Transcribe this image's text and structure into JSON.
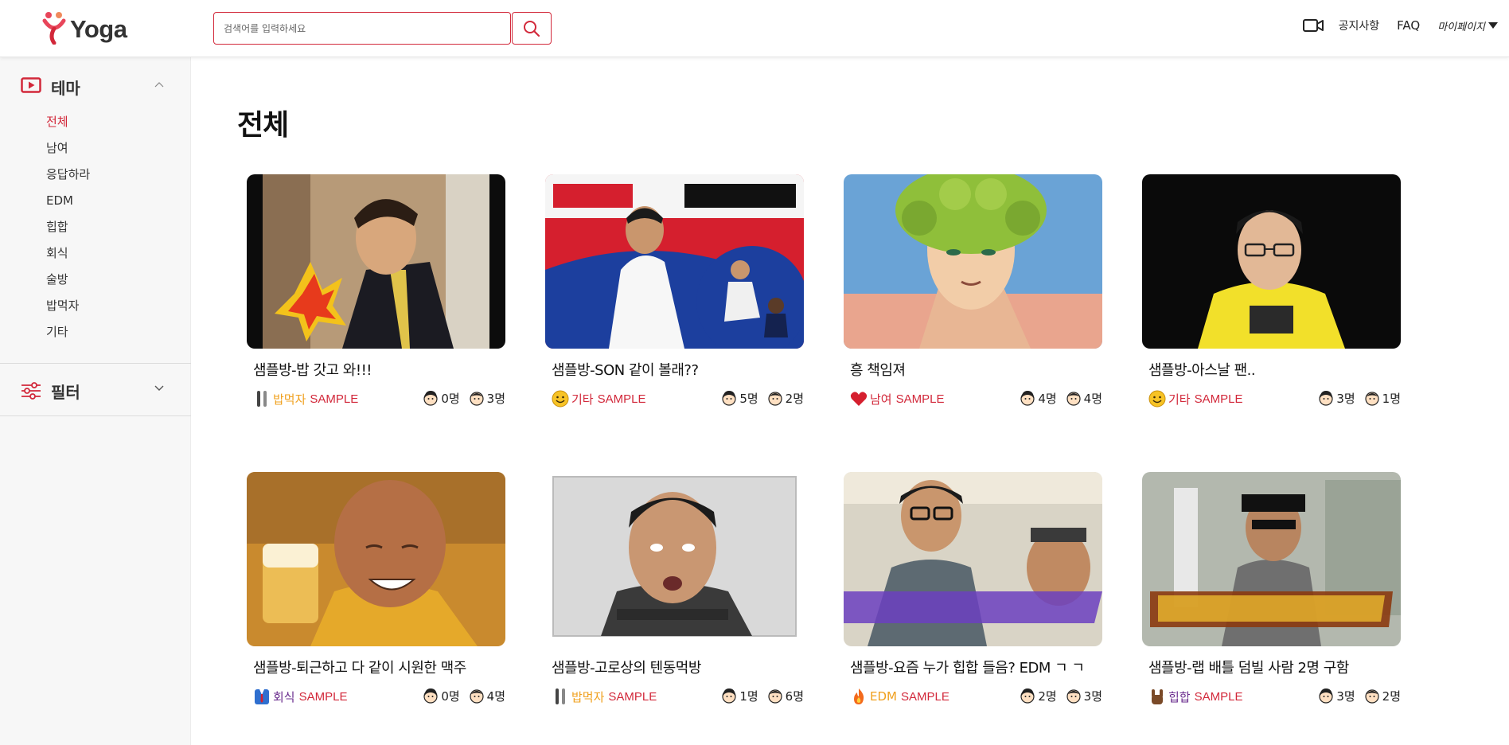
{
  "header": {
    "logo_text": "Yoga",
    "search": {
      "placeholder": "검색어를 입력하세요",
      "value": ""
    },
    "nav": {
      "notice": "공지사항",
      "faq": "FAQ",
      "mypage": "마이페이지"
    }
  },
  "sidebar": {
    "theme_title": "테마",
    "theme_items": [
      "전체",
      "남여",
      "응답하라",
      "EDM",
      "힙합",
      "회식",
      "술방",
      "밥먹자",
      "기타"
    ],
    "active_index": 0,
    "filter_title": "필터"
  },
  "main": {
    "page_title": "전체",
    "sample_label": "SAMPLE",
    "cards": [
      {
        "title": "샘플방-밥 갓고 와!!!",
        "category": "밥먹자",
        "category_color": "#f0a01e",
        "category_icon": "utensils-icon",
        "female": "0명",
        "male": "3명"
      },
      {
        "title": "샘플방-SON 같이 볼래??",
        "category": "기타",
        "category_color": "#d2283a",
        "category_icon": "smile-emoji-icon",
        "female": "5명",
        "male": "2명"
      },
      {
        "title": "흥 책임져",
        "category": "남여",
        "category_color": "#d2283a",
        "category_icon": "heart-icon",
        "female": "4명",
        "male": "4명"
      },
      {
        "title": "샘플방-아스날 팬..",
        "category": "기타",
        "category_color": "#d2283a",
        "category_icon": "smile-emoji-icon",
        "female": "3명",
        "male": "1명"
      },
      {
        "title": "샘플방-퇴근하고 다 같이 시원한 맥주",
        "category": "회식",
        "category_color": "#6a2c8e",
        "category_icon": "suit-icon",
        "female": "0명",
        "male": "4명"
      },
      {
        "title": "샘플방-고로상의 텐동먹방",
        "category": "밥먹자",
        "category_color": "#f0a01e",
        "category_icon": "utensils-icon",
        "female": "1명",
        "male": "6명"
      },
      {
        "title": "샘플방-요즘 누가 힙합 들음? EDM ㄱ ㄱ",
        "category": "EDM",
        "category_color": "#f0a01e",
        "category_icon": "fire-icon",
        "female": "2명",
        "male": "3명"
      },
      {
        "title": "샘플방-랩 배틀 덤빌 사람 2명 구함",
        "category": "힙합",
        "category_color": "#6a2c8e",
        "category_icon": "rock-hand-icon",
        "female": "3명",
        "male": "2명"
      }
    ]
  }
}
